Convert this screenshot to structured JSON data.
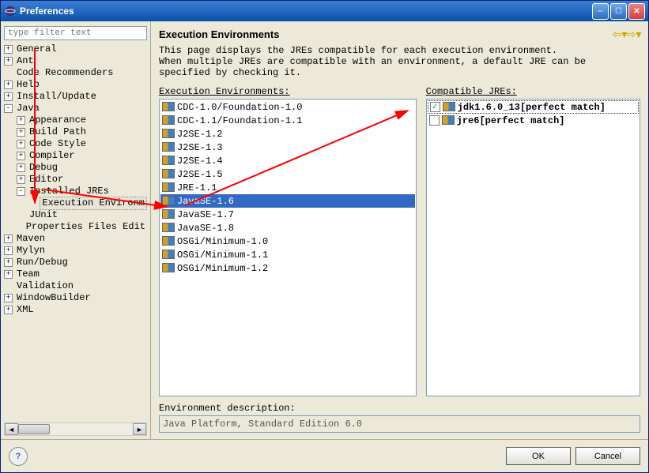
{
  "window": {
    "title": "Preferences"
  },
  "filter": {
    "placeholder": "type filter text"
  },
  "tree": [
    {
      "d": 0,
      "t": "+",
      "l": "General"
    },
    {
      "d": 0,
      "t": "+",
      "l": "Ant"
    },
    {
      "d": 0,
      "t": "",
      "l": "Code Recommenders"
    },
    {
      "d": 0,
      "t": "+",
      "l": "Help"
    },
    {
      "d": 0,
      "t": "+",
      "l": "Install/Update"
    },
    {
      "d": 0,
      "t": "-",
      "l": "Java"
    },
    {
      "d": 1,
      "t": "+",
      "l": "Appearance"
    },
    {
      "d": 1,
      "t": "+",
      "l": "Build Path"
    },
    {
      "d": 1,
      "t": "+",
      "l": "Code Style"
    },
    {
      "d": 1,
      "t": "+",
      "l": "Compiler"
    },
    {
      "d": 1,
      "t": "+",
      "l": "Debug"
    },
    {
      "d": 1,
      "t": "+",
      "l": "Editor"
    },
    {
      "d": 1,
      "t": "-",
      "l": "Installed JREs"
    },
    {
      "d": 2,
      "t": "",
      "l": "Execution Environm",
      "sel": true
    },
    {
      "d": 1,
      "t": "",
      "l": "JUnit"
    },
    {
      "d": 1,
      "t": "",
      "l": "Properties Files Edit"
    },
    {
      "d": 0,
      "t": "+",
      "l": "Maven"
    },
    {
      "d": 0,
      "t": "+",
      "l": "Mylyn"
    },
    {
      "d": 0,
      "t": "+",
      "l": "Run/Debug"
    },
    {
      "d": 0,
      "t": "+",
      "l": "Team"
    },
    {
      "d": 0,
      "t": "",
      "l": "Validation"
    },
    {
      "d": 0,
      "t": "+",
      "l": "WindowBuilder"
    },
    {
      "d": 0,
      "t": "+",
      "l": "XML"
    }
  ],
  "page": {
    "title": "Execution Environments",
    "desc1": "This page displays the JREs compatible for each execution environment.",
    "desc2": "When multiple JREs are compatible with an environment, a default JRE can be specified by checking it.",
    "envs_label": "Execution Environments:",
    "jres_label": "Compatible JREs:",
    "envs": [
      "CDC-1.0/Foundation-1.0",
      "CDC-1.1/Foundation-1.1",
      "J2SE-1.2",
      "J2SE-1.3",
      "J2SE-1.4",
      "J2SE-1.5",
      "JRE-1.1",
      "JavaSE-1.6",
      "JavaSE-1.7",
      "JavaSE-1.8",
      "OSGi/Minimum-1.0",
      "OSGi/Minimum-1.1",
      "OSGi/Minimum-1.2"
    ],
    "selected_env_index": 7,
    "jres": [
      {
        "checked": true,
        "name": "jdk1.6.0_13",
        "suffix": "[perfect match]",
        "hl": true
      },
      {
        "checked": false,
        "name": "jre6",
        "suffix": "[perfect match]",
        "hl": false
      }
    ],
    "env_desc_label": "Environment description:",
    "env_desc_value": "Java Platform, Standard Edition 6.0"
  },
  "buttons": {
    "ok": "OK",
    "cancel": "Cancel"
  }
}
